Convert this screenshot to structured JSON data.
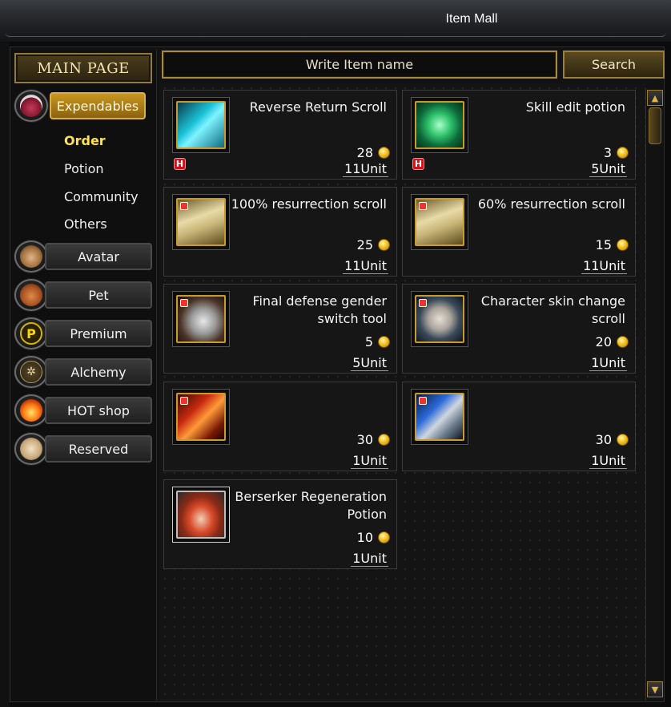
{
  "window": {
    "title": "Item Mall"
  },
  "sidebar": {
    "main_page_label": "MAIN PAGE",
    "categories": [
      {
        "label": "Expendables",
        "icon": "potion-flask-icon",
        "active": true
      },
      {
        "label": "Avatar",
        "icon": "avatar-face-icon",
        "active": false
      },
      {
        "label": "Pet",
        "icon": "pet-squirrel-icon",
        "active": false
      },
      {
        "label": "Premium",
        "icon": "premium-p-icon",
        "active": false
      },
      {
        "label": "Alchemy",
        "icon": "alchemy-circle-icon",
        "active": false
      },
      {
        "label": "HOT shop",
        "icon": "flame-icon",
        "active": false
      },
      {
        "label": "Reserved",
        "icon": "reserved-bag-icon",
        "active": false
      }
    ],
    "subcategories": [
      {
        "label": "Order",
        "active": true
      },
      {
        "label": "Potion",
        "active": false
      },
      {
        "label": "Community",
        "active": false
      },
      {
        "label": "Others",
        "active": false
      }
    ]
  },
  "search": {
    "placeholder": "Write Item name",
    "button_label": "Search"
  },
  "items": [
    {
      "name": "Reverse Return Scroll",
      "price": "28",
      "unit": "11Unit",
      "icon": "return-scroll-icon",
      "hot_badge": "H"
    },
    {
      "name": "Skill edit potion",
      "price": "3",
      "unit": "5Unit",
      "icon": "skill-potion-icon",
      "hot_badge": "H"
    },
    {
      "name": "100% resurrection scroll",
      "price": "25",
      "unit": "11Unit",
      "icon": "resurrection-scroll-icon",
      "hot_badge": ""
    },
    {
      "name": "60% resurrection scroll",
      "price": "15",
      "unit": "11Unit",
      "icon": "resurrection-scroll-icon",
      "hot_badge": ""
    },
    {
      "name": "Final defense gender switch tool",
      "price": "5",
      "unit": "5Unit",
      "icon": "gender-switch-tool-icon",
      "hot_badge": ""
    },
    {
      "name": "Character skin change scroll",
      "price": "20",
      "unit": "1Unit",
      "icon": "skin-change-scroll-icon",
      "hot_badge": ""
    },
    {
      "name": "",
      "price": "30",
      "unit": "1Unit",
      "icon": "fire-axe-icon",
      "hot_badge": ""
    },
    {
      "name": "",
      "price": "30",
      "unit": "1Unit",
      "icon": "blue-shield-icon",
      "hot_badge": ""
    },
    {
      "name": "Berserker Regeneration Potion",
      "price": "10",
      "unit": "1Unit",
      "icon": "berserker-potion-icon",
      "hot_badge": ""
    }
  ],
  "colors": {
    "accent_gold": "#c9961f",
    "active_subcategory": "#ffe34d",
    "hot_badge": "#d0121b"
  }
}
